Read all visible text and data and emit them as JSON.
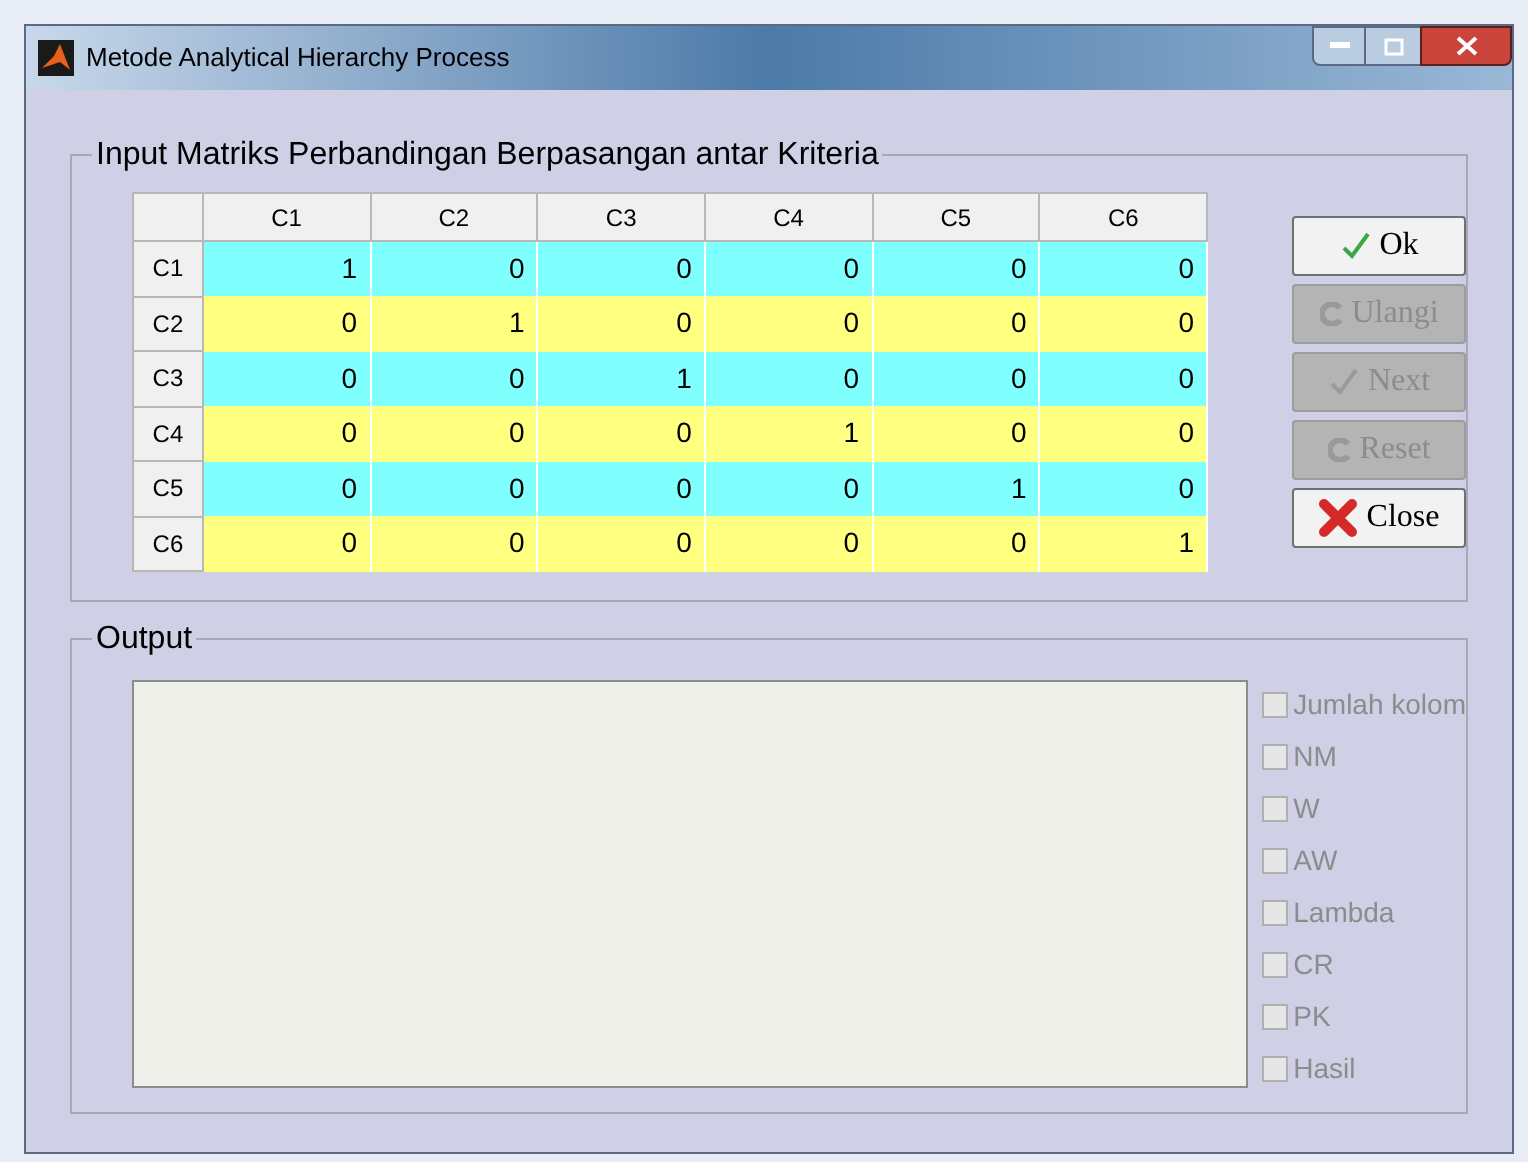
{
  "window": {
    "title": "Metode Analytical Hierarchy Process"
  },
  "input_panel": {
    "title": "Input Matriks Perbandingan Berpasangan antar Kriteria",
    "table": {
      "columns": [
        "C1",
        "C2",
        "C3",
        "C4",
        "C5",
        "C6"
      ],
      "rows": [
        {
          "header": "C1",
          "color": "#80ffff",
          "cells": [
            "1",
            "0",
            "0",
            "0",
            "0",
            "0"
          ]
        },
        {
          "header": "C2",
          "color": "#ffff80",
          "cells": [
            "0",
            "1",
            "0",
            "0",
            "0",
            "0"
          ]
        },
        {
          "header": "C3",
          "color": "#80ffff",
          "cells": [
            "0",
            "0",
            "1",
            "0",
            "0",
            "0"
          ]
        },
        {
          "header": "C4",
          "color": "#ffff80",
          "cells": [
            "0",
            "0",
            "0",
            "1",
            "0",
            "0"
          ]
        },
        {
          "header": "C5",
          "color": "#80ffff",
          "cells": [
            "0",
            "0",
            "0",
            "0",
            "1",
            "0"
          ]
        },
        {
          "header": "C6",
          "color": "#ffff80",
          "cells": [
            "0",
            "0",
            "0",
            "0",
            "0",
            "1"
          ]
        }
      ]
    },
    "buttons": [
      {
        "label": "Ok",
        "kind": "check",
        "disabled": false
      },
      {
        "label": "Ulangi",
        "kind": "reset",
        "disabled": true
      },
      {
        "label": "Next",
        "kind": "check",
        "disabled": true
      },
      {
        "label": "Reset",
        "kind": "reset",
        "disabled": true
      },
      {
        "label": "Close",
        "kind": "close",
        "disabled": false
      }
    ]
  },
  "output_panel": {
    "title": "Output",
    "checkboxes": [
      {
        "label": "Jumlah kolom",
        "checked": false,
        "disabled": true
      },
      {
        "label": "NM",
        "checked": false,
        "disabled": true
      },
      {
        "label": "W",
        "checked": false,
        "disabled": true
      },
      {
        "label": "AW",
        "checked": false,
        "disabled": true
      },
      {
        "label": "Lambda",
        "checked": false,
        "disabled": true
      },
      {
        "label": "CR",
        "checked": false,
        "disabled": true
      },
      {
        "label": "PK",
        "checked": false,
        "disabled": true
      },
      {
        "label": "Hasil",
        "checked": false,
        "disabled": true
      }
    ]
  }
}
